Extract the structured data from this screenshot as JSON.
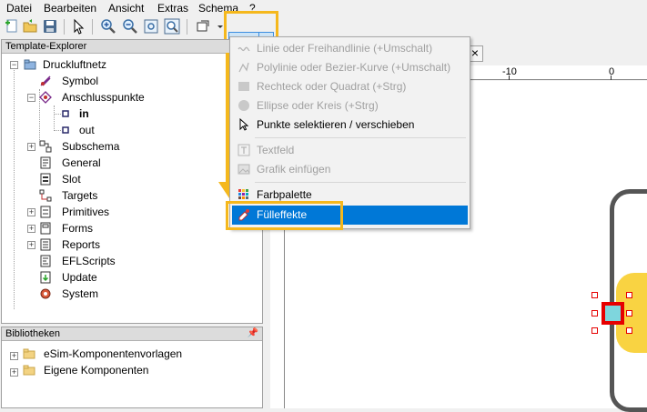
{
  "menubar": [
    "Datei",
    "Bearbeiten",
    "Ansicht",
    "Extras",
    "Schema",
    "?"
  ],
  "toolbar": {
    "icons": [
      "new-page-icon",
      "open-folder-icon",
      "save-icon",
      "select-arrow-icon",
      "zoom-in-icon",
      "zoom-out-icon",
      "zoom-fit-icon",
      "zoom-area-icon",
      "shape-dropdown-icon",
      "freehand-line-icon"
    ]
  },
  "explorer": {
    "title": "Template-Explorer",
    "items": [
      {
        "label": "Druckluftnetz",
        "icon": "folder-icon"
      },
      {
        "label": "Symbol",
        "icon": "symbol-icon"
      },
      {
        "label": "Anschlusspunkte",
        "icon": "connection-icon"
      },
      {
        "label": "in",
        "icon": "point-icon"
      },
      {
        "label": "out",
        "icon": "point-icon"
      },
      {
        "label": "Subschema",
        "icon": "subschema-icon"
      },
      {
        "label": "General",
        "icon": "general-icon"
      },
      {
        "label": "Slot",
        "icon": "slot-icon"
      },
      {
        "label": "Targets",
        "icon": "targets-icon"
      },
      {
        "label": "Primitives",
        "icon": "primitives-icon"
      },
      {
        "label": "Forms",
        "icon": "forms-icon"
      },
      {
        "label": "Reports",
        "icon": "reports-icon"
      },
      {
        "label": "EFLScripts",
        "icon": "scripts-icon"
      },
      {
        "label": "Update",
        "icon": "update-icon"
      },
      {
        "label": "System",
        "icon": "system-icon"
      }
    ]
  },
  "library": {
    "title": "Bibliotheken",
    "pin": "📌",
    "items": [
      {
        "label": "eSim-Komponentenvorlagen"
      },
      {
        "label": "Eigene Komponenten"
      }
    ]
  },
  "ruler": {
    "labels": [
      "-10",
      "0"
    ]
  },
  "tab_close": "×",
  "dropdown_menu": {
    "items": [
      {
        "label": "Linie oder Freihandlinie (+Umschalt)",
        "disabled": true
      },
      {
        "label": "Polylinie oder Bezier-Kurve (+Umschalt)",
        "disabled": true
      },
      {
        "label": "Rechteck oder Quadrat (+Strg)",
        "disabled": true
      },
      {
        "label": "Ellipse oder Kreis (+Strg)",
        "disabled": true
      },
      {
        "label": "Punkte selektieren / verschieben",
        "disabled": false
      },
      {
        "label": "Textfeld",
        "disabled": true
      },
      {
        "label": "Grafik einfügen",
        "disabled": true
      },
      {
        "label": "Farbpalette",
        "disabled": false
      },
      {
        "label": "Fülleffekte",
        "disabled": false,
        "selected": true
      }
    ]
  },
  "colors": {
    "highlight": "#f5b81d",
    "selection": "#0078d7",
    "handle": "#e60000",
    "fill_yellow": "#f9d342",
    "port_cyan": "#7ed6dd"
  }
}
